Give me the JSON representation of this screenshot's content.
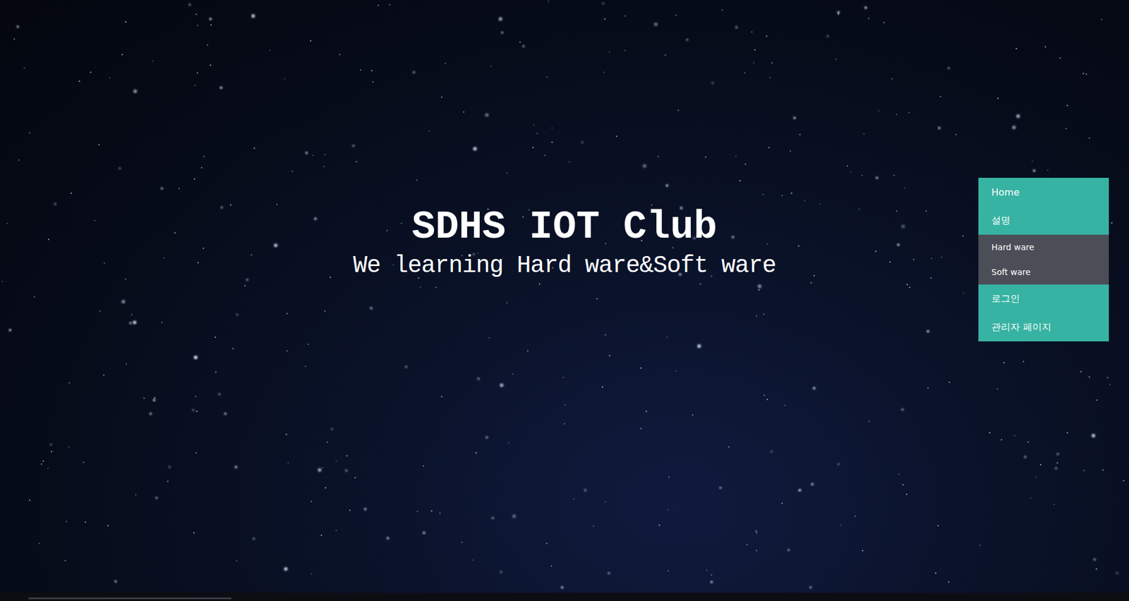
{
  "header": {
    "title": "SDHS IOT Club",
    "subtitle": "We learning Hard ware&Soft ware"
  },
  "menu": [
    {
      "label": "Home",
      "kind": "main"
    },
    {
      "label": "설명",
      "kind": "main"
    },
    {
      "label": "Hard ware",
      "kind": "sub"
    },
    {
      "label": "Soft ware",
      "kind": "sub"
    },
    {
      "label": "로그인",
      "kind": "main"
    },
    {
      "label": "관리자 페이지",
      "kind": "main"
    }
  ]
}
